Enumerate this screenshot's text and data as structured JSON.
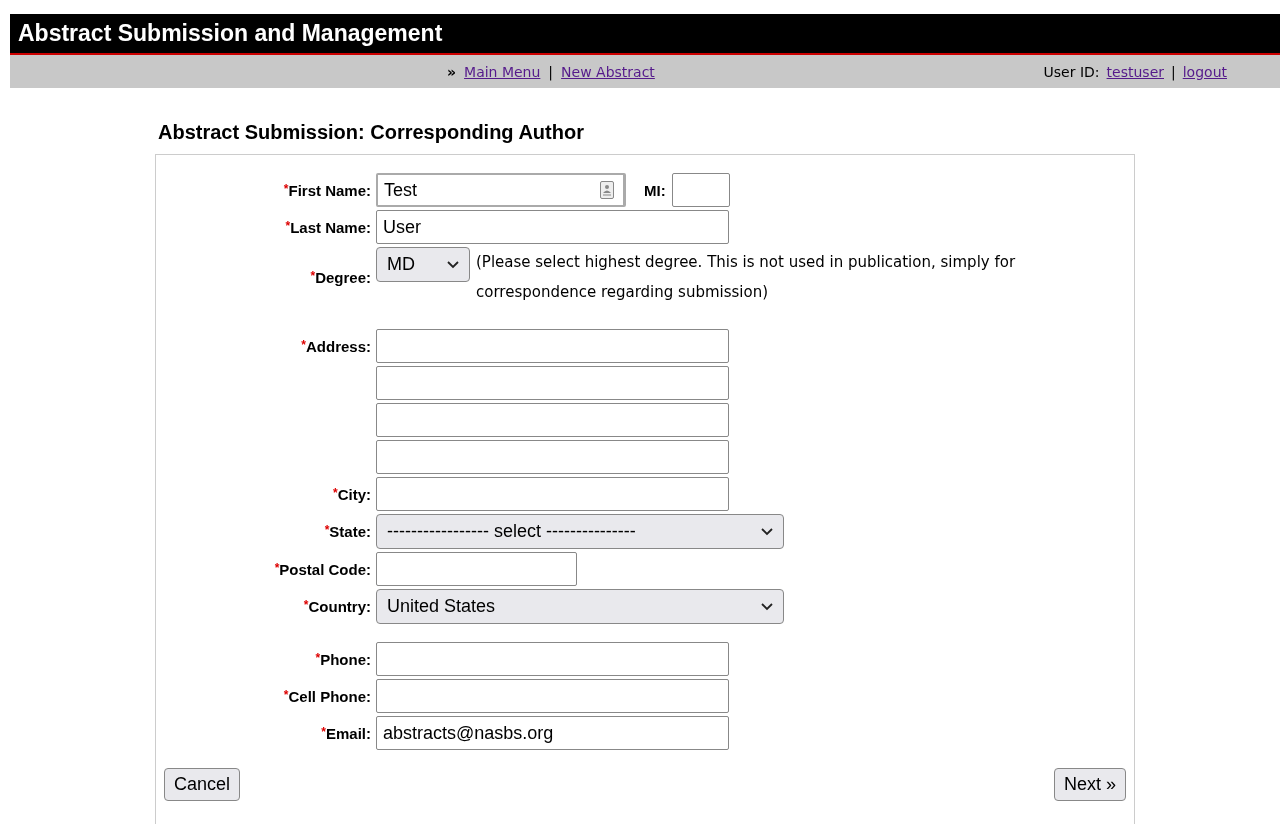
{
  "header": {
    "title": "Abstract Submission and Management"
  },
  "nav": {
    "prefix": "»",
    "items": [
      {
        "kind": "link",
        "text": "Main Menu"
      },
      {
        "kind": "sep",
        "text": "|"
      },
      {
        "kind": "link",
        "text": "New Abstract"
      }
    ],
    "user": [
      {
        "kind": "text",
        "text": "User ID:"
      },
      {
        "kind": "link",
        "text": "testuser"
      },
      {
        "kind": "sep",
        "text": "|"
      },
      {
        "kind": "link",
        "text": "logout"
      }
    ]
  },
  "page_title": "Abstract Submission: Corresponding Author",
  "fields": [
    {
      "kind": "text",
      "marker": "*",
      "label": "First Name:",
      "value": "Test",
      "autofill": true,
      "extra": {
        "label": "MI:"
      }
    },
    {
      "kind": "text",
      "marker": "*",
      "label": "Last Name:",
      "value": "User"
    },
    {
      "kind": "select",
      "marker": "*",
      "label": "Degree:",
      "value": "MD",
      "note": "(Please select highest degree. This is not used in publication, simply for correspondence regarding submission)"
    },
    {
      "kind": "text",
      "marker": "*",
      "label": "Address:"
    },
    {
      "kind": "text"
    },
    {
      "kind": "text"
    },
    {
      "kind": "text"
    },
    {
      "kind": "text",
      "marker": "*",
      "label": "City:"
    },
    {
      "kind": "select",
      "marker": "*",
      "label": "State:",
      "value": "----------------- select ---------------"
    },
    {
      "kind": "text",
      "marker": "*",
      "label": "Postal Code:"
    },
    {
      "kind": "select",
      "marker": "*",
      "label": "Country:",
      "value": "United States"
    },
    {
      "kind": "text",
      "marker": "*",
      "label": "Phone:"
    },
    {
      "kind": "text",
      "marker": "*",
      "label": "Cell Phone:"
    },
    {
      "kind": "text",
      "marker": "*",
      "label": "Email:",
      "value": "abstracts@nasbs.org"
    }
  ],
  "buttons": [
    {
      "label": "Cancel"
    },
    {
      "label": "Next »"
    }
  ]
}
